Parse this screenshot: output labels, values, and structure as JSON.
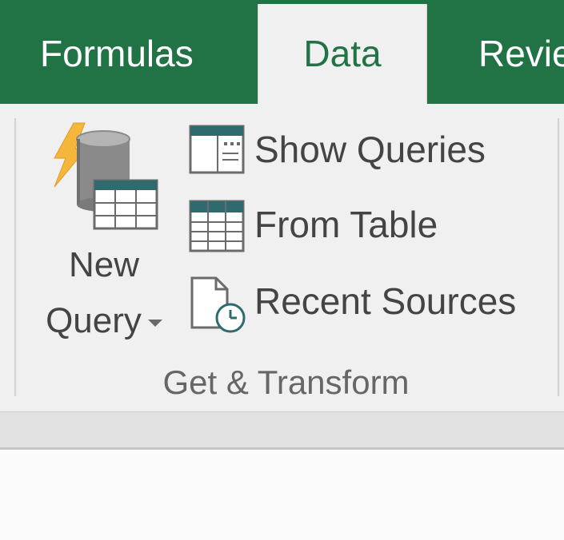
{
  "tabs": {
    "formulas": "Formulas",
    "data": "Data",
    "review": "Revie"
  },
  "ribbon": {
    "new_query": {
      "line1": "New",
      "line2": "Query",
      "icon": "new-query-icon"
    },
    "commands": {
      "show_queries": {
        "label": "Show Queries",
        "icon": "show-queries-icon"
      },
      "from_table": {
        "label": "From Table",
        "icon": "from-table-icon"
      },
      "recent_sources": {
        "label": "Recent Sources",
        "icon": "recent-sources-icon"
      }
    },
    "group_label": "Get & Transform"
  },
  "colors": {
    "accent": "#217346",
    "ribbon_bg": "#f0f0f0",
    "text": "#444444",
    "icon_teal": "#2f6b6e"
  }
}
